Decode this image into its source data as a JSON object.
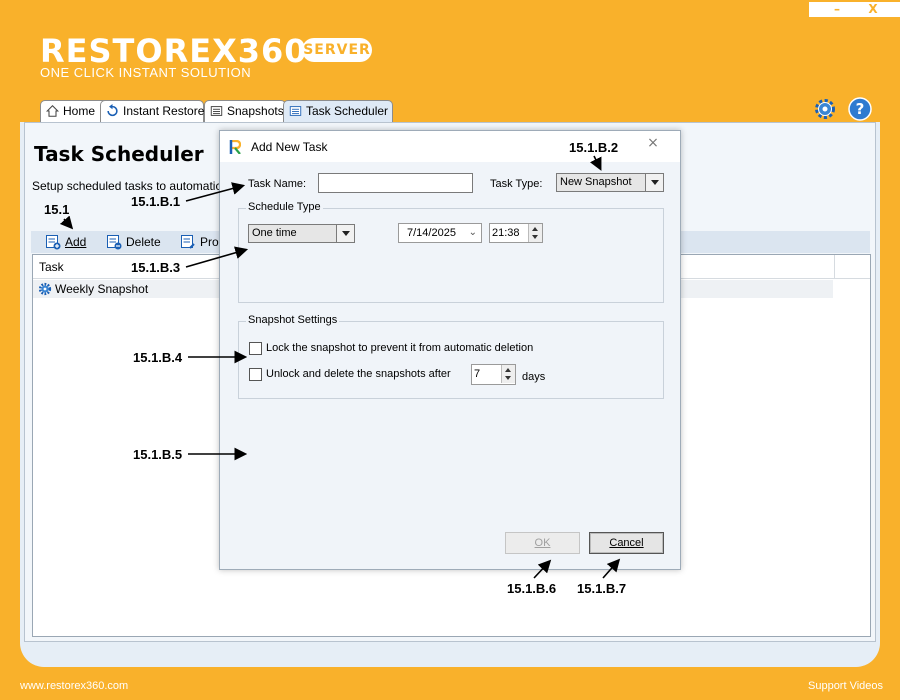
{
  "window": {
    "minimize_label": "–",
    "close_label": "X"
  },
  "brand": {
    "name": "RESTOREX360",
    "badge": "SERVER",
    "tagline": "ONE CLICK INSTANT SOLUTION",
    "color": "#F9B12B"
  },
  "tabs": [
    {
      "label": "Home",
      "icon": "home-icon"
    },
    {
      "label": "Instant Restore",
      "icon": "restore-icon"
    },
    {
      "label": "Snapshots",
      "icon": "snapshots-icon"
    },
    {
      "label": "Task Scheduler",
      "icon": "task-scheduler-icon",
      "active": true
    }
  ],
  "main": {
    "title": "Task Scheduler",
    "description": "Setup scheduled tasks to automatically",
    "toolbar": {
      "add_label": "Add",
      "delete_label": "Delete",
      "properties_label": "Prop"
    },
    "grid": {
      "column_task": "Task",
      "rows": [
        {
          "task": "Weekly Snapshot"
        }
      ]
    }
  },
  "dialog": {
    "title": "Add New Task",
    "task_name_label": "Task Name:",
    "task_name_value": "",
    "task_type_label": "Task Type:",
    "task_type_value": "New Snapshot",
    "schedule_group_label": "Schedule Type",
    "schedule_type_value": "One time",
    "date_value": "7/14/2025",
    "time_value": "21:38",
    "snapshot_group_label": "Snapshot Settings",
    "lock_label": "Lock the snapshot to prevent it from automatic deletion",
    "unlock_label": "Unlock and delete the snapshots after",
    "days_value": "7",
    "days_label": "days",
    "ok_label": "OK",
    "cancel_label": "Cancel"
  },
  "annotations": {
    "a1": "15.1",
    "a2": "15.1.B.1",
    "a3": "15.1.B.2",
    "a4": "15.1.B.3",
    "a5": "15.1.B.4",
    "a6": "15.1.B.5",
    "a7": "15.1.B.6",
    "a8": "15.1.B.7"
  },
  "footer": {
    "website": "www.restorex360.com",
    "support": "Support Videos"
  }
}
